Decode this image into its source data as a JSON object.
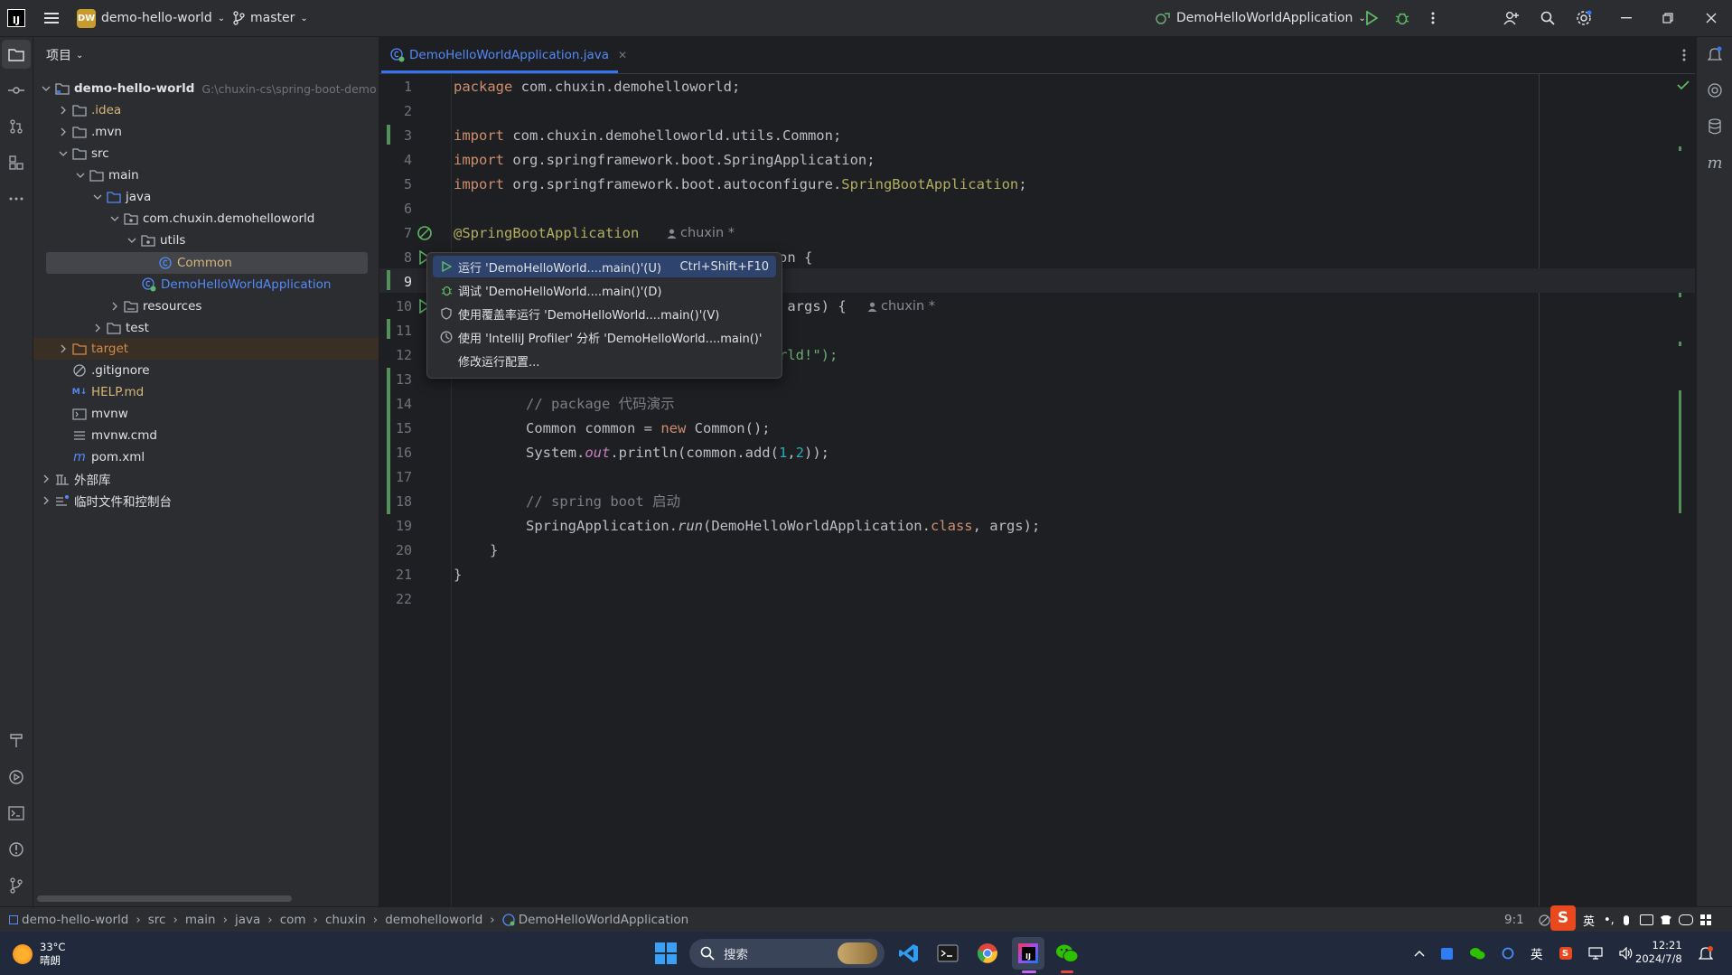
{
  "app": {
    "logo_text": "IJ",
    "project_badge": "DW",
    "project_name": "demo-hello-world",
    "branch": "master",
    "run_config": "DemoHelloWorldApplication"
  },
  "project_panel": {
    "title": "项目",
    "tree": [
      {
        "label": "demo-hello-world",
        "path": "G:\\chuxin-cs\\spring-boot-demo"
      },
      {
        "label": ".idea"
      },
      {
        "label": ".mvn"
      },
      {
        "label": "src"
      },
      {
        "label": "main"
      },
      {
        "label": "java"
      },
      {
        "label": "com.chuxin.demohelloworld"
      },
      {
        "label": "utils"
      },
      {
        "label": "Common"
      },
      {
        "label": "DemoHelloWorldApplication"
      },
      {
        "label": "resources"
      },
      {
        "label": "test"
      },
      {
        "label": "target"
      },
      {
        "label": ".gitignore"
      },
      {
        "label": "HELP.md"
      },
      {
        "label": "mvnw"
      },
      {
        "label": "mvnw.cmd"
      },
      {
        "label": "pom.xml"
      },
      {
        "label": "外部库"
      },
      {
        "label": "临时文件和控制台"
      }
    ]
  },
  "editor": {
    "tab": "DemoHelloWorldApplication.java",
    "line_numbers": [
      "1",
      "2",
      "3",
      "4",
      "5",
      "6",
      "7",
      "8",
      "9",
      "10",
      "11",
      "12",
      "13",
      "14",
      "15",
      "16",
      "17",
      "18",
      "19",
      "20",
      "21",
      "22"
    ],
    "code": {
      "l1_kw": "package",
      "l1_rest": " com.chuxin.demohelloworld;",
      "l3_kw": "import",
      "l3_rest": " com.chuxin.demohelloworld.utils.Common;",
      "l4_kw": "import",
      "l4_rest": " org.springframework.boot.SpringApplication;",
      "l5_kw": "import",
      "l5_rest": " org.springframework.boot.autoconfigure.",
      "l5_ann": "SpringBootApplication",
      "l5_end": ";",
      "l7_ann": "@SpringBootApplication",
      "l8_tail": "on {",
      "l10_tail": " args) {",
      "l12_tail": "rld!\");",
      "l14_comment": "// package 代码演示",
      "l15_a": "Common common = ",
      "l15_kw": "new",
      "l15_b": " Common();",
      "l16_a": "System.",
      "l16_out": "out",
      "l16_b": ".println(common.add(",
      "l16_n1": "1",
      "l16_c": ",",
      "l16_n2": "2",
      "l16_d": "));",
      "l18_comment": "// spring boot 启动",
      "l19_a": "SpringApplication.",
      "l19_run": "run",
      "l19_b": "(DemoHelloWorldApplication.",
      "l19_kw": "class",
      "l19_c": ", args);",
      "l20": "}",
      "l21": "}"
    },
    "inlay_author_1": "chuxin *",
    "inlay_author_2": "chuxin *"
  },
  "popup_menu": {
    "items": [
      {
        "label": "运行 'DemoHelloWorld....main()'(U)",
        "shortcut": "Ctrl+Shift+F10"
      },
      {
        "label": "调试 'DemoHelloWorld....main()'(D)"
      },
      {
        "label": "使用覆盖率运行 'DemoHelloWorld....main()'(V)"
      },
      {
        "label": "使用 'IntelliJ Profiler' 分析  'DemoHelloWorld....main()'"
      },
      {
        "label": "修改运行配置..."
      }
    ]
  },
  "statusbar": {
    "breadcrumbs": [
      "demo-hello-world",
      "src",
      "main",
      "java",
      "com",
      "chuxin",
      "demohelloworld",
      "DemoHelloWorldApplication"
    ],
    "position": "9:1",
    "ime": "英"
  },
  "taskbar": {
    "weather_temp": "33°C",
    "weather_desc": "晴朗",
    "search_placeholder": "搜索",
    "tray_lang": "英",
    "time": "12:21",
    "date": "2024/7/8"
  },
  "colors": {
    "accent": "#3574f0",
    "bg_editor": "#1e1f22",
    "bg_panel": "#2b2d30",
    "keyword": "#cf8e6d",
    "annotation": "#b3ae60",
    "run_green": "#5fb865"
  }
}
